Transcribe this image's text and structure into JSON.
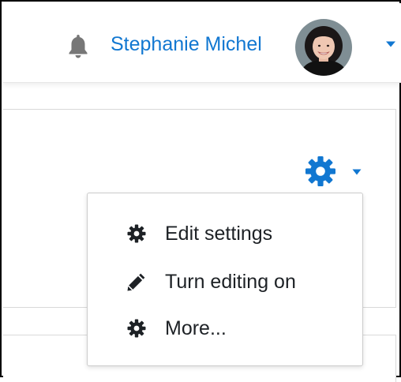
{
  "navbar": {
    "notifications_icon": "bell-icon",
    "user_name": "Stephanie Michel",
    "avatar_alt": "Stephanie Michel",
    "user_menu_icon": "caret-down-icon",
    "accent_color": "#1177d1"
  },
  "settings_menu": {
    "toggle_icon": "gear-icon",
    "caret_icon": "caret-down-icon",
    "items": [
      {
        "label": "Edit settings",
        "icon": "gear-icon"
      },
      {
        "label": "Turn editing on",
        "icon": "pencil-icon"
      },
      {
        "label": "More...",
        "icon": "gear-icon"
      }
    ]
  }
}
